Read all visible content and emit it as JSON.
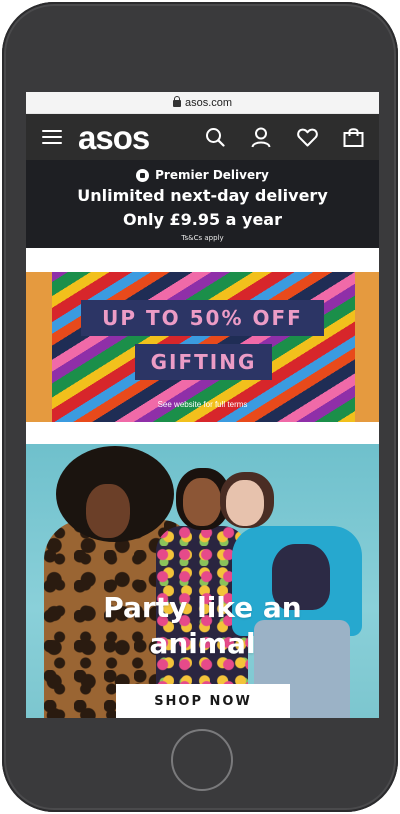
{
  "browser": {
    "url": "asos.com"
  },
  "nav": {
    "logo": "asos",
    "icons": [
      "menu-icon",
      "search-icon",
      "account-icon",
      "heart-icon",
      "bag-icon"
    ]
  },
  "premier": {
    "label": "Premier Delivery",
    "line1": "Unlimited next-day delivery",
    "line2": "Only £9.95 a year",
    "terms": "Ts&Cs apply"
  },
  "gifting": {
    "line1": "UP TO 50% OFF",
    "line2": "GIFTING",
    "terms": "See website for full terms"
  },
  "party": {
    "title_line1": "Party like an",
    "title_line2": "animal",
    "cta": "SHOP NOW"
  },
  "colors": {
    "nav_bg": "#2d2d2d",
    "premier_bg": "#1e1f23",
    "gifting_block": "#2c3565",
    "gifting_text": "#ec9cc6",
    "party_bg": "#7cc6cf",
    "phone_frame": "#3a3a3c"
  }
}
